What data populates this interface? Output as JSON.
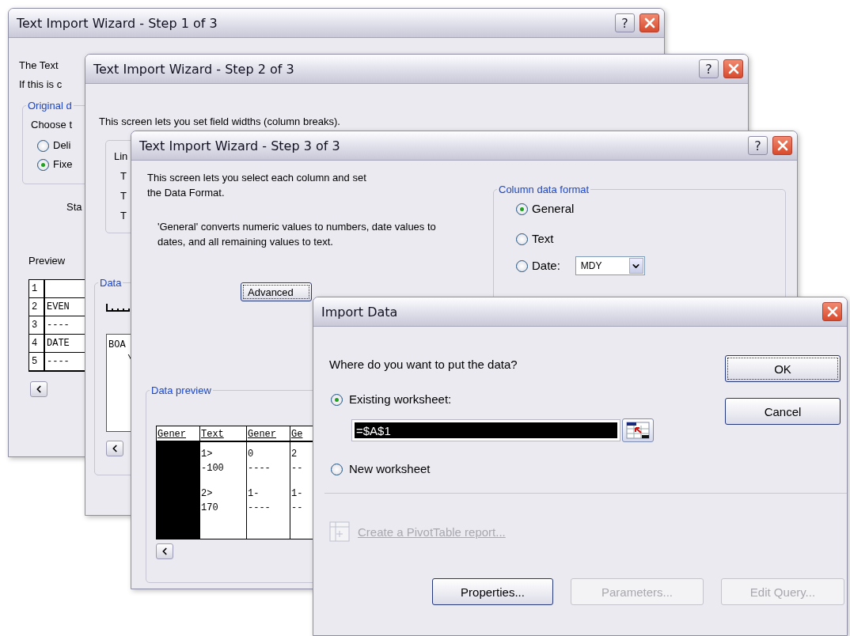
{
  "step1": {
    "title": "Text Import Wizard - Step 1 of 3",
    "help": "?",
    "intro": [
      "The Text",
      "If this is c"
    ],
    "group": "Original d",
    "prompt": "Choose t",
    "options": [
      {
        "label": "Deli",
        "selected": false
      },
      {
        "label": "Fixe",
        "selected": true
      }
    ],
    "start_label": "Sta",
    "preview_label": "Preview",
    "rows": [
      {
        "number": "1"
      },
      {
        "number": "2",
        "text": "EVEN"
      },
      {
        "number": "3",
        "text": "----"
      },
      {
        "number": "4",
        "text": "DATE"
      },
      {
        "number": "5",
        "text": "----"
      }
    ]
  },
  "step2": {
    "title": "Text Import Wizard - Step 2 of 3",
    "help": "?",
    "intro": "This screen lets you set field widths (column breaks).",
    "group": "Lin",
    "group_lines": [
      "T",
      "T",
      "T"
    ],
    "preview_label": "Data",
    "preview_lines": [
      "BOA",
      "\\"
    ]
  },
  "step3": {
    "title": "Text Import Wizard - Step 3 of 3",
    "help": "?",
    "intro": "This screen lets you select each column and set the Data Format.",
    "note": "'General' converts numeric values to numbers, date values to dates, and all remaining values to text.",
    "advanced": "Advanced",
    "format_group": "Column data format",
    "formats": [
      {
        "kind": "plain",
        "label": "General",
        "selected": true
      },
      {
        "kind": "plain",
        "label": "Text",
        "selected": false
      },
      {
        "kind": "date",
        "label": "Date:",
        "selected": false,
        "value": "MDY"
      }
    ],
    "preview_label": "Data preview",
    "columns": [
      {
        "header": "Gener",
        "selected": true
      },
      {
        "header": "Text",
        "selected": false,
        "records": [
          [
            "1>",
            "-100"
          ],
          [
            "2>",
            "170"
          ]
        ]
      },
      {
        "header": "Gener",
        "selected": false,
        "records": [
          [
            "0",
            "----"
          ],
          [
            "1-",
            "----"
          ]
        ]
      },
      {
        "header": "Ge",
        "selected": false,
        "records": [
          [
            "2",
            "--"
          ],
          [
            "1-",
            "--"
          ]
        ]
      }
    ]
  },
  "import_data": {
    "title": "Import Data",
    "question": "Where do you want to put the data?",
    "destinations": [
      {
        "label": "Existing worksheet:",
        "selected": true,
        "value": "=$A$1"
      },
      {
        "label": "New worksheet",
        "selected": false
      }
    ],
    "pivot_link": {
      "label": "Create a PivotTable report...",
      "disabled": true
    },
    "side_buttons": [
      "OK",
      "Cancel"
    ],
    "bottom_buttons": [
      {
        "label": "Properties...",
        "disabled": false
      },
      {
        "label": "Parameters...",
        "disabled": true
      },
      {
        "label": "Edit Query...",
        "disabled": true
      }
    ]
  }
}
